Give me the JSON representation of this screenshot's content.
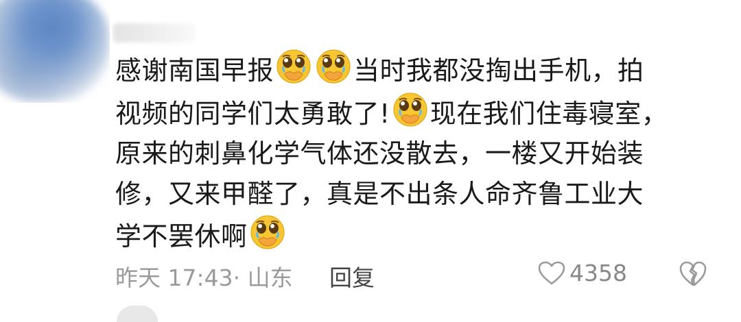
{
  "comment": {
    "lines": [
      [
        "感谢南国早报",
        "EMOJI",
        "EMOJI",
        "当时我都没掏出手机，拍"
      ],
      [
        "视频的同学们太勇敢了!",
        "EMOJI",
        "现在我们住毒寝室，"
      ],
      [
        "原来的刺鼻化学气体还没散去，一楼又开始装"
      ],
      [
        "修，又来甲醛了，真是不出条人命齐鲁工业大"
      ],
      [
        "学不罢休啊",
        "EMOJI"
      ]
    ],
    "emoji_name": "pleading-face-emoji"
  },
  "meta": {
    "time_location": "昨天 17:43· 山东",
    "reply_label": "回复",
    "like_count": "4358"
  },
  "colors": {
    "text": "#1a1a1a",
    "meta": "#9a9a9a",
    "emoji_face": "#f7c733"
  }
}
